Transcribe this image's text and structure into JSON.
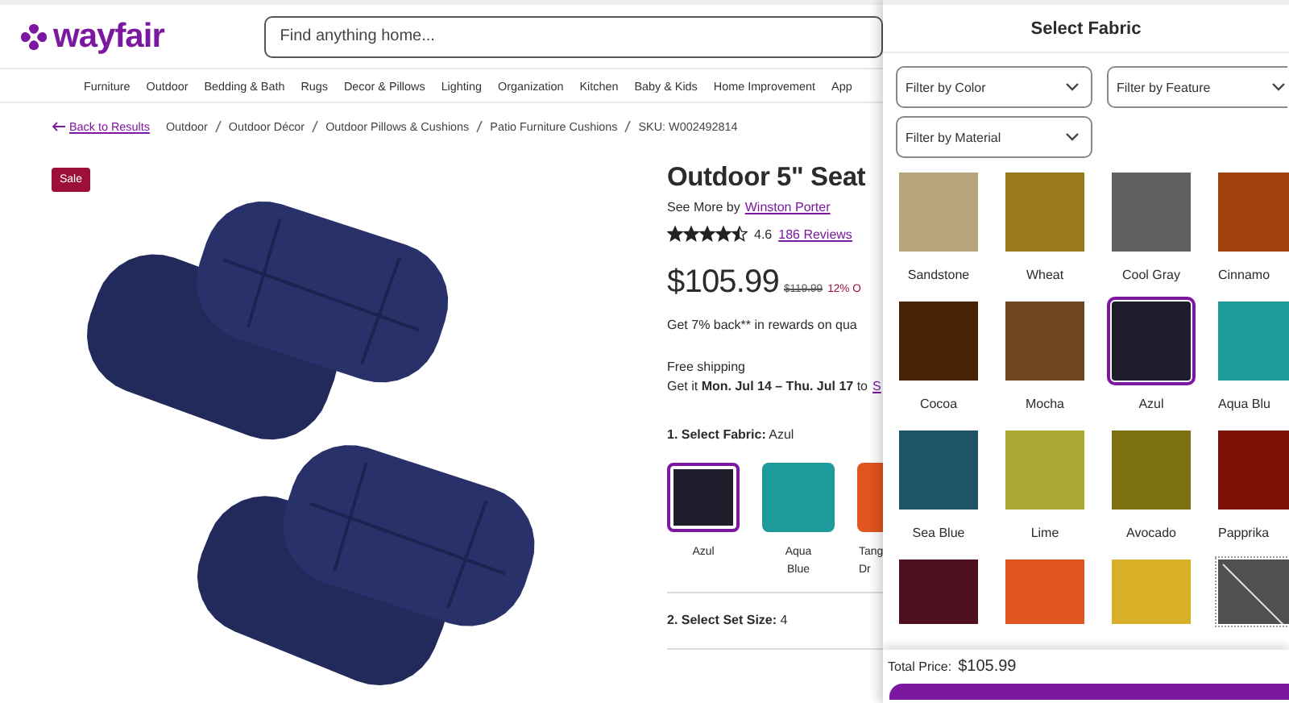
{
  "header": {
    "logo": "wayfair",
    "search": {
      "placeholder": "Find anything home..."
    }
  },
  "nav": [
    "Furniture",
    "Outdoor",
    "Bedding & Bath",
    "Rugs",
    "Decor & Pillows",
    "Lighting",
    "Organization",
    "Kitchen",
    "Baby & Kids",
    "Home Improvement",
    "App"
  ],
  "breadcrumb": {
    "back": "Back to Results",
    "path": [
      "Outdoor",
      "Outdoor Décor",
      "Outdoor Pillows & Cushions",
      "Patio Furniture Cushions",
      "SKU: W002492814"
    ]
  },
  "product": {
    "badge": "Sale",
    "title": "Outdoor 5\" Seat",
    "brand_prefix": "See More by",
    "brand": "Winston Porter",
    "stars": 4.5,
    "rating": "4.6",
    "reviews": "186 Reviews",
    "price": "$105.99",
    "was_price": "$119.99",
    "discount": "12% O",
    "rewards": "Get 7% back** in rewards on qua",
    "shipping": "Free shipping",
    "delivery": "Get it **Mon. Jul 14 – Thu. Jul 17** to",
    "delivery_link": "S",
    "fabric_label": "1. Select Fabric:",
    "fabric_value": "Azul",
    "swatches": [
      {
        "label": "Azul",
        "color": "#1d1d2b",
        "selected": true
      },
      {
        "label": "Aqua Blue",
        "color": "#1e9a9c",
        "selected": false
      },
      {
        "label": "Tang Dr",
        "color": "#e05520",
        "selected": false
      }
    ],
    "set_size_label": "2. Select Set Size:",
    "set_size_value": "4"
  },
  "panel": {
    "title": "Select Fabric",
    "filters": [
      "Filter by Color",
      "Filter by Feature",
      "Filter by Material"
    ],
    "fabrics": [
      {
        "label": "Sandstone",
        "color": "#b8a47c",
        "selected": false,
        "kind": "available"
      },
      {
        "label": "Wheat",
        "color": "#9a7a1a",
        "selected": false,
        "kind": "available"
      },
      {
        "label": "Cool Gray",
        "color": "#5f5f5f",
        "selected": false,
        "kind": "available"
      },
      {
        "label": "Cinnamo",
        "color": "#a0400c",
        "selected": false,
        "kind": "available"
      },
      {
        "label": "Cocoa",
        "color": "#4a2208",
        "selected": false,
        "kind": "available"
      },
      {
        "label": "Mocha",
        "color": "#6e4520",
        "selected": false,
        "kind": "available"
      },
      {
        "label": "Azul",
        "color": "#1d1d2b",
        "selected": true,
        "kind": "available"
      },
      {
        "label": "Aqua Blu",
        "color": "#1e9a9c",
        "selected": false,
        "kind": "available"
      },
      {
        "label": "Sea Blue",
        "color": "#1f5466",
        "selected": false,
        "kind": "available"
      },
      {
        "label": "Lime",
        "color": "#a8a832",
        "selected": false,
        "kind": "available"
      },
      {
        "label": "Avocado",
        "color": "#7d7010",
        "selected": false,
        "kind": "available"
      },
      {
        "label": "Papprika",
        "color": "#7c1208",
        "selected": false,
        "kind": "available"
      },
      {
        "color": "#4e1020",
        "selected": false,
        "kind": "available"
      },
      {
        "color": "#e05520",
        "selected": false,
        "kind": "available"
      },
      {
        "color": "#d8b028",
        "selected": false,
        "kind": "available"
      },
      {
        "color": "#505050",
        "selected": false,
        "kind": "unavailable"
      }
    ],
    "total_label": "Total Price:",
    "total": "$105.99"
  }
}
